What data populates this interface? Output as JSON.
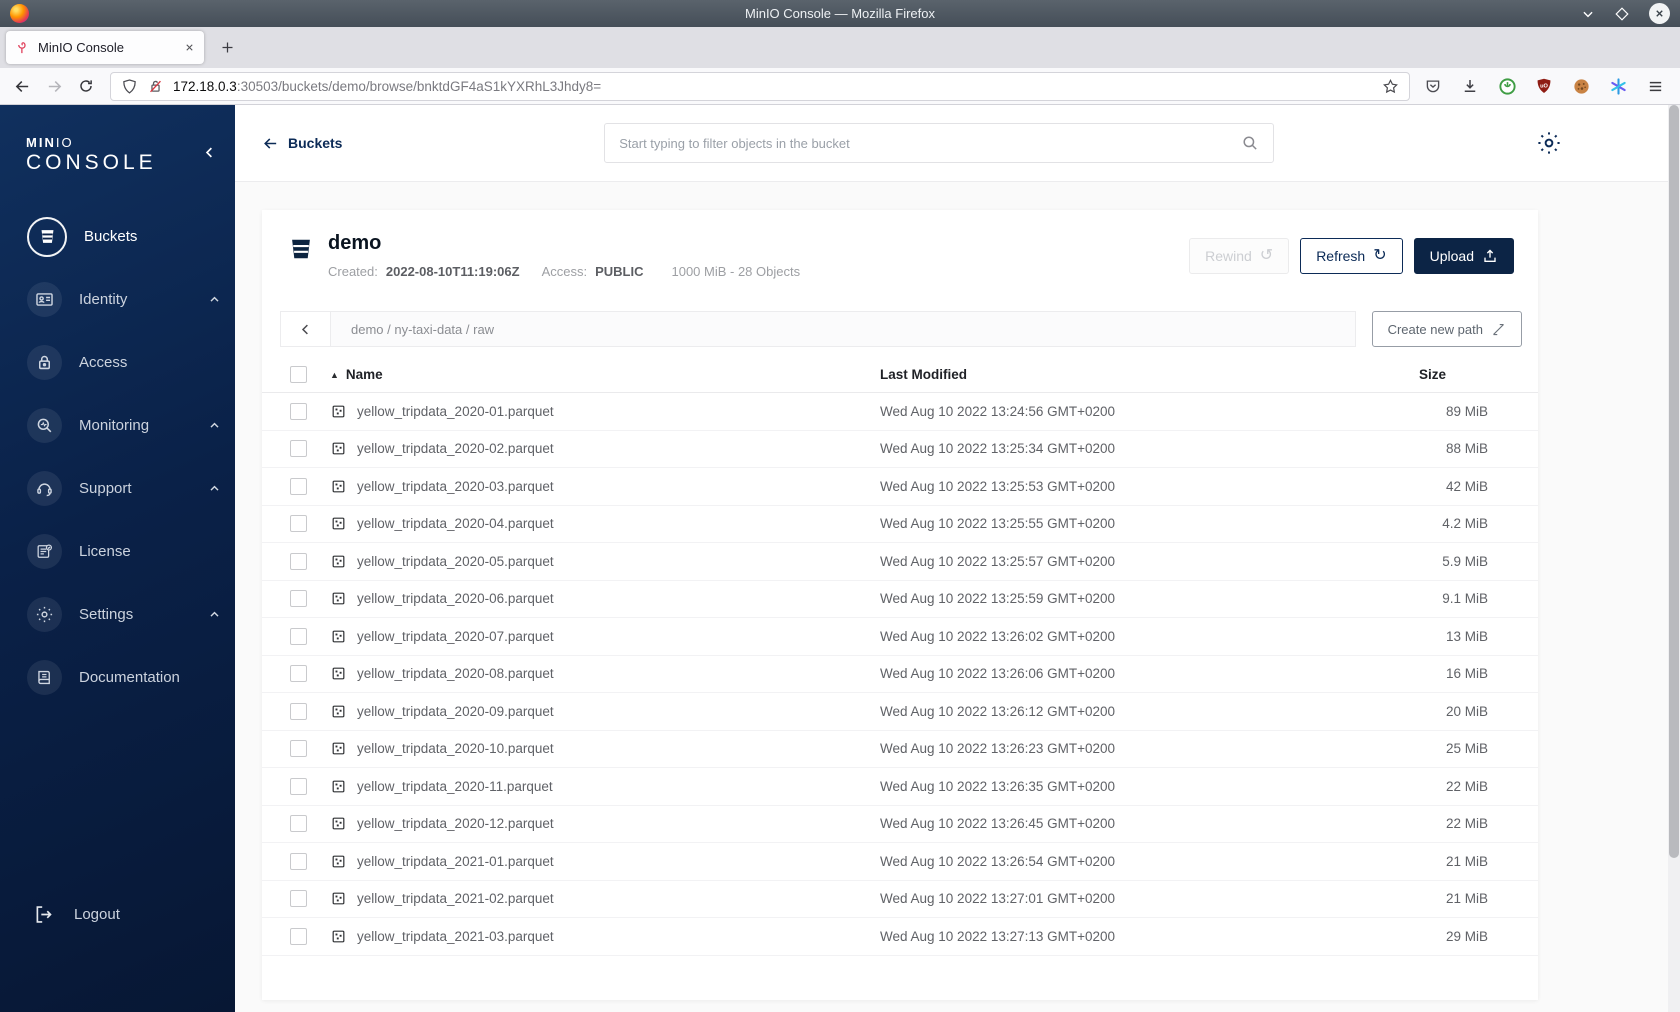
{
  "titlebar": {
    "title": "MinIO Console — Mozilla Firefox"
  },
  "tab": {
    "title": "MinIO Console"
  },
  "urlbar": {
    "host": "172.18.0.3",
    "path": ":30503/buckets/demo/browse/bnktdGF4aS1kYXRhL3Jhdy8="
  },
  "sidebar": {
    "logo": {
      "brand_bold": "MIN",
      "brand_light": "IO",
      "product": "CONSOLE"
    },
    "items": [
      {
        "label": "Buckets",
        "icon": "bucket-icon",
        "active": true,
        "expandable": false
      },
      {
        "label": "Identity",
        "icon": "identity-card-icon",
        "active": false,
        "expandable": true
      },
      {
        "label": "Access",
        "icon": "lock-icon",
        "active": false,
        "expandable": false
      },
      {
        "label": "Monitoring",
        "icon": "monitoring-icon",
        "active": false,
        "expandable": true
      },
      {
        "label": "Support",
        "icon": "headset-icon",
        "active": false,
        "expandable": true
      },
      {
        "label": "License",
        "icon": "license-icon",
        "active": false,
        "expandable": false
      },
      {
        "label": "Settings",
        "icon": "gear-icon",
        "active": false,
        "expandable": true
      },
      {
        "label": "Documentation",
        "icon": "book-icon",
        "active": false,
        "expandable": false
      }
    ],
    "logout": {
      "label": "Logout",
      "icon": "logout-icon"
    }
  },
  "topbar": {
    "back_label": "Buckets",
    "search_placeholder": "Start typing to filter objects in the bucket"
  },
  "bucket": {
    "name": "demo",
    "created_label": "Created:",
    "created_value": "2022-08-10T11:19:06Z",
    "access_label": "Access:",
    "access_value": "PUBLIC",
    "usage": "1000 MiB - 28 Objects",
    "rewind_label": "Rewind",
    "refresh_label": "Refresh",
    "upload_label": "Upload",
    "rewind_glyph": "↺",
    "refresh_glyph": "↻"
  },
  "browse": {
    "path": "demo / ny-taxi-data / raw",
    "create_path_label": "Create new path"
  },
  "objects": {
    "columns": {
      "name": "Name",
      "modified": "Last Modified",
      "size": "Size"
    },
    "sort_glyph": "▲",
    "rows": [
      {
        "name": "yellow_tripdata_2020-01.parquet",
        "modified": "Wed Aug 10 2022 13:24:56 GMT+0200",
        "size": "89 MiB"
      },
      {
        "name": "yellow_tripdata_2020-02.parquet",
        "modified": "Wed Aug 10 2022 13:25:34 GMT+0200",
        "size": "88 MiB"
      },
      {
        "name": "yellow_tripdata_2020-03.parquet",
        "modified": "Wed Aug 10 2022 13:25:53 GMT+0200",
        "size": "42 MiB"
      },
      {
        "name": "yellow_tripdata_2020-04.parquet",
        "modified": "Wed Aug 10 2022 13:25:55 GMT+0200",
        "size": "4.2 MiB"
      },
      {
        "name": "yellow_tripdata_2020-05.parquet",
        "modified": "Wed Aug 10 2022 13:25:57 GMT+0200",
        "size": "5.9 MiB"
      },
      {
        "name": "yellow_tripdata_2020-06.parquet",
        "modified": "Wed Aug 10 2022 13:25:59 GMT+0200",
        "size": "9.1 MiB"
      },
      {
        "name": "yellow_tripdata_2020-07.parquet",
        "modified": "Wed Aug 10 2022 13:26:02 GMT+0200",
        "size": "13 MiB"
      },
      {
        "name": "yellow_tripdata_2020-08.parquet",
        "modified": "Wed Aug 10 2022 13:26:06 GMT+0200",
        "size": "16 MiB"
      },
      {
        "name": "yellow_tripdata_2020-09.parquet",
        "modified": "Wed Aug 10 2022 13:26:12 GMT+0200",
        "size": "20 MiB"
      },
      {
        "name": "yellow_tripdata_2020-10.parquet",
        "modified": "Wed Aug 10 2022 13:26:23 GMT+0200",
        "size": "25 MiB"
      },
      {
        "name": "yellow_tripdata_2020-11.parquet",
        "modified": "Wed Aug 10 2022 13:26:35 GMT+0200",
        "size": "22 MiB"
      },
      {
        "name": "yellow_tripdata_2020-12.parquet",
        "modified": "Wed Aug 10 2022 13:26:45 GMT+0200",
        "size": "22 MiB"
      },
      {
        "name": "yellow_tripdata_2021-01.parquet",
        "modified": "Wed Aug 10 2022 13:26:54 GMT+0200",
        "size": "21 MiB"
      },
      {
        "name": "yellow_tripdata_2021-02.parquet",
        "modified": "Wed Aug 10 2022 13:27:01 GMT+0200",
        "size": "21 MiB"
      },
      {
        "name": "yellow_tripdata_2021-03.parquet",
        "modified": "Wed Aug 10 2022 13:27:13 GMT+0200",
        "size": "29 MiB"
      }
    ]
  },
  "colors": {
    "accent_navy": "#0c2445",
    "sidebar_navy": "#0a2148",
    "page_bg": "#fafafa"
  }
}
